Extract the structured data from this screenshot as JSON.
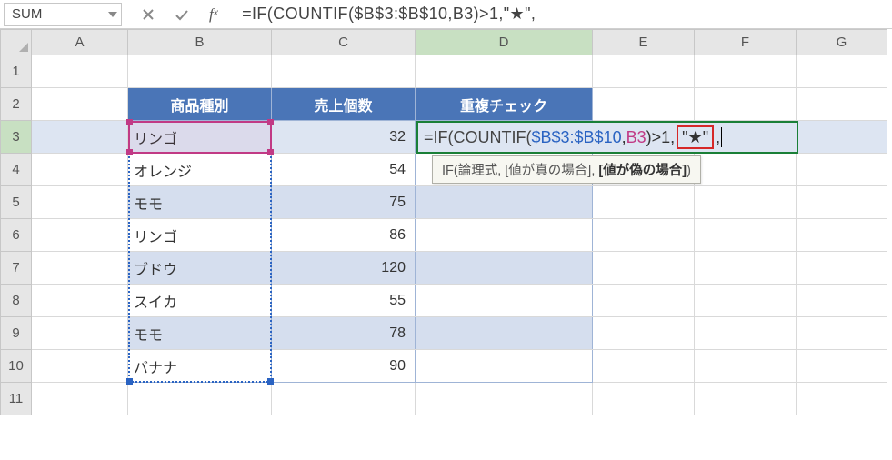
{
  "name_box": "SUM",
  "formula_bar": {
    "prefix": "=IF(COUNTIF($B$3:$B$10,B3)>1,\"★\","
  },
  "columns": [
    "A",
    "B",
    "C",
    "D",
    "E",
    "F",
    "G"
  ],
  "row_count": 11,
  "active_col": "D",
  "active_row": 3,
  "headers": {
    "B": "商品種別",
    "C": "売上個数",
    "D": "重複チェック"
  },
  "rows": [
    {
      "r": 3,
      "b": "リンゴ",
      "c": "32"
    },
    {
      "r": 4,
      "b": "オレンジ",
      "c": "54"
    },
    {
      "r": 5,
      "b": "モモ",
      "c": "75"
    },
    {
      "r": 6,
      "b": "リンゴ",
      "c": "86"
    },
    {
      "r": 7,
      "b": "ブドウ",
      "c": "120"
    },
    {
      "r": 8,
      "b": "スイカ",
      "c": "55"
    },
    {
      "r": 9,
      "b": "モモ",
      "c": "78"
    },
    {
      "r": 10,
      "b": "バナナ",
      "c": "90"
    }
  ],
  "edit": {
    "front": "=IF(COUNTIF(",
    "range": "$B$3:$B$10",
    "comma1": ",",
    "ref": "B3",
    "mid": ")>1,",
    "star": "\"★\"",
    "comma2": ","
  },
  "tooltip": {
    "fn": "IF(",
    "arg1": "論理式",
    "sep1": ", ",
    "arg2": "[値が真の場合]",
    "sep2": ", ",
    "arg3": "[値が偽の場合]",
    "close": ")"
  }
}
